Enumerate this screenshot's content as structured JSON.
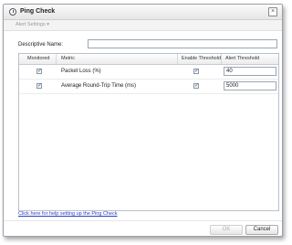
{
  "dialog": {
    "title": "Ping Check",
    "close_label": "×",
    "alert_settings_label": "Alert Settings ▾"
  },
  "form": {
    "descriptive_name_label": "Descriptive Name:",
    "descriptive_name_value": ""
  },
  "grid": {
    "columns": [
      "Monitored",
      "Metric",
      "Enable Threshold",
      "Alert Threshold"
    ],
    "rows": [
      {
        "monitored": true,
        "metric": "Packet Loss (%)",
        "enable_threshold": true,
        "alert_threshold": "40"
      },
      {
        "monitored": true,
        "metric": "Average Round-Trip Time (ms)",
        "enable_threshold": true,
        "alert_threshold": "5000"
      }
    ]
  },
  "help_link": "Click here for help setting up the Ping Check",
  "buttons": {
    "ok": "OK",
    "cancel": "Cancel"
  },
  "colors": {
    "link": "#2a3fc4",
    "disabled_text": "#b0b0b0",
    "check": "#2a5ca8"
  },
  "icons": {
    "title": "clock-icon",
    "close": "close-icon",
    "check": "checkmark-icon"
  }
}
